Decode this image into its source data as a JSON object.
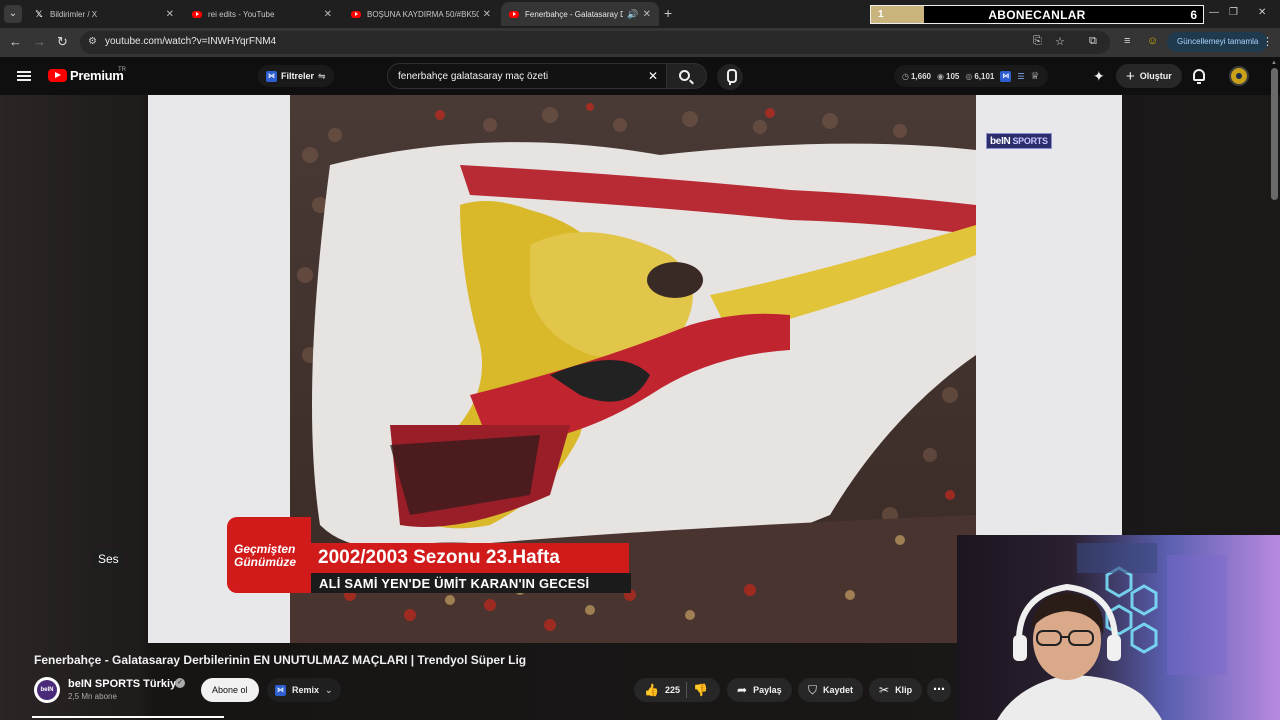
{
  "browser": {
    "tabs": [
      {
        "title": "Bildirimler / X",
        "favicon": "x-logo-icon",
        "active": false
      },
      {
        "title": "rei edits - YouTube",
        "favicon": "youtube-icon",
        "active": false
      },
      {
        "title": "BOŞUNA KAYDIRMA 50/#BK50",
        "favicon": "youtube-icon",
        "active": false
      },
      {
        "title": "Fenerbahçe - Galatasaray D",
        "favicon": "youtube-icon",
        "active": true,
        "audio": true
      }
    ],
    "url": "youtube.com/watch?v=INWHYqrFNM4",
    "update_button": "Güncellemeyi tamamla"
  },
  "subscriber_goal": {
    "label": "ABONECANLAR",
    "current": "1",
    "target": "6",
    "progress_fraction": 0.16,
    "fill_color": "#c9b47e"
  },
  "youtube": {
    "logo_text": "Premium",
    "country_code": "TR",
    "filters_label": "Filtreler",
    "search_query": "fenerbahçe galatasaray maç özeti",
    "stats": {
      "a": "1,660",
      "b": "105",
      "c": "6,101"
    },
    "create_label": "Oluştur"
  },
  "video": {
    "overlay_network": "beIN",
    "overlay_network_suffix": "SPORTS",
    "lower_third": {
      "badge_line1": "Geçmişten",
      "badge_line2": "Günümüze",
      "headline": "2002/2003 Sezonu 23.Hafta",
      "subline": "ALİ SAMİ YEN'DE ÜMİT KARAN'IN GECESİ"
    },
    "tooltip": "Ses",
    "title": "Fenerbahçe - Galatasaray Derbilerinin EN UNUTULMAZ MAÇLARI | Trendyol Süper Lig",
    "channel_name": "beIN SPORTS Türkiye",
    "subscribers": "2,5 Mn abone",
    "subscribe_label": "Abone ol",
    "remix_label": "Remix",
    "likes": "225",
    "share_label": "Paylaş",
    "save_label": "Kaydet",
    "clip_label": "Klip"
  }
}
